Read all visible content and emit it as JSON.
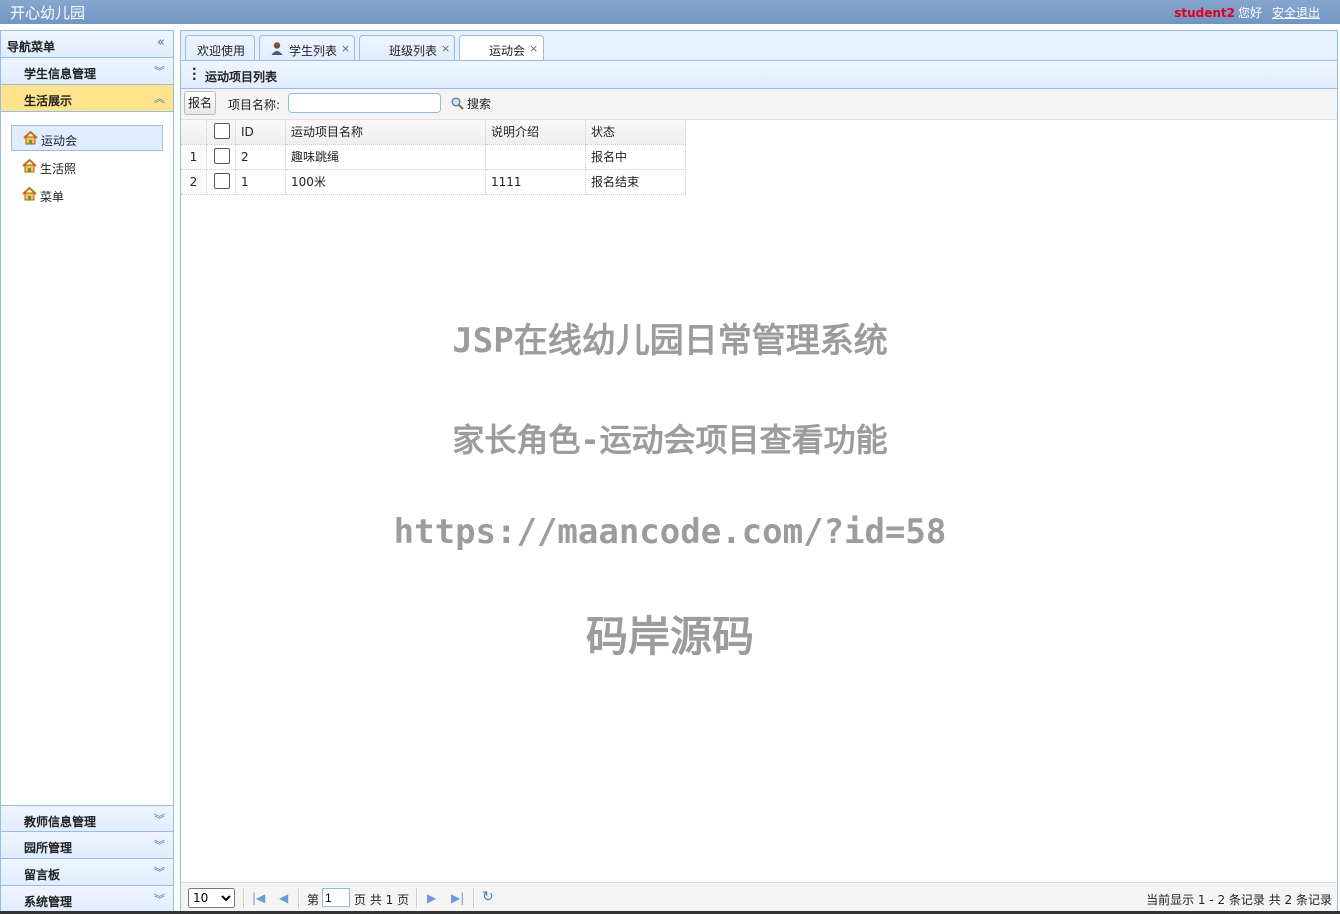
{
  "app": {
    "title": "开心幼儿园"
  },
  "user": {
    "name": "student2",
    "greeting": "您好",
    "logout": "安全退出"
  },
  "sidebar": {
    "title": "导航菜单",
    "sections_top": [
      {
        "label": "学生信息管理",
        "active": false
      },
      {
        "label": "生活展示",
        "active": true
      }
    ],
    "items": [
      {
        "label": "运动会",
        "selected": true
      },
      {
        "label": "生活照",
        "selected": false
      },
      {
        "label": "菜单",
        "selected": false
      }
    ],
    "sections_bottom": [
      {
        "label": "教师信息管理"
      },
      {
        "label": "园所管理"
      },
      {
        "label": "留言板"
      },
      {
        "label": "系统管理"
      }
    ]
  },
  "tabs": [
    {
      "label": "欢迎使用",
      "closable": false,
      "active": false
    },
    {
      "label": "学生列表",
      "closable": true,
      "active": false,
      "icon": "student-icon"
    },
    {
      "label": "班级列表",
      "closable": true,
      "active": false
    },
    {
      "label": "运动会",
      "closable": true,
      "active": true
    }
  ],
  "panel": {
    "title": "运动项目列表"
  },
  "toolbar": {
    "signup_label": "报名",
    "name_label": "项目名称:",
    "search_value": "",
    "search_label": "搜索"
  },
  "grid": {
    "columns": [
      "ID",
      "运动项目名称",
      "说明介绍",
      "状态"
    ],
    "rows": [
      {
        "rownum": "1",
        "id": "2",
        "name": "趣味跳绳",
        "desc": "",
        "status": "报名中"
      },
      {
        "rownum": "2",
        "id": "1",
        "name": "100米",
        "desc": "1111",
        "status": "报名结束"
      }
    ]
  },
  "watermark": {
    "line1": "JSP在线幼儿园日常管理系统",
    "line2": "家长角色-运动会项目查看功能",
    "line3": "https://maancode.com/?id=58",
    "line4": "码岸源码"
  },
  "pager": {
    "page_size": "10",
    "page_prefix": "第",
    "page_value": "1",
    "page_suffix": "页 共 1 页",
    "info": "当前显示 1 - 2 条记录 共 2 条记录"
  },
  "colors": {
    "header": "#7a9cc8",
    "accent": "#99bbe8",
    "active_section": "#ffe48d",
    "username": "#e0001a"
  },
  "icons": [
    "collapse-left-icon",
    "chevron-down-icon",
    "chevron-up-icon",
    "house-icon",
    "student-icon",
    "close-icon",
    "kebab-icon",
    "search-icon",
    "first-page-icon",
    "prev-page-icon",
    "next-page-icon",
    "last-page-icon",
    "refresh-icon"
  ]
}
